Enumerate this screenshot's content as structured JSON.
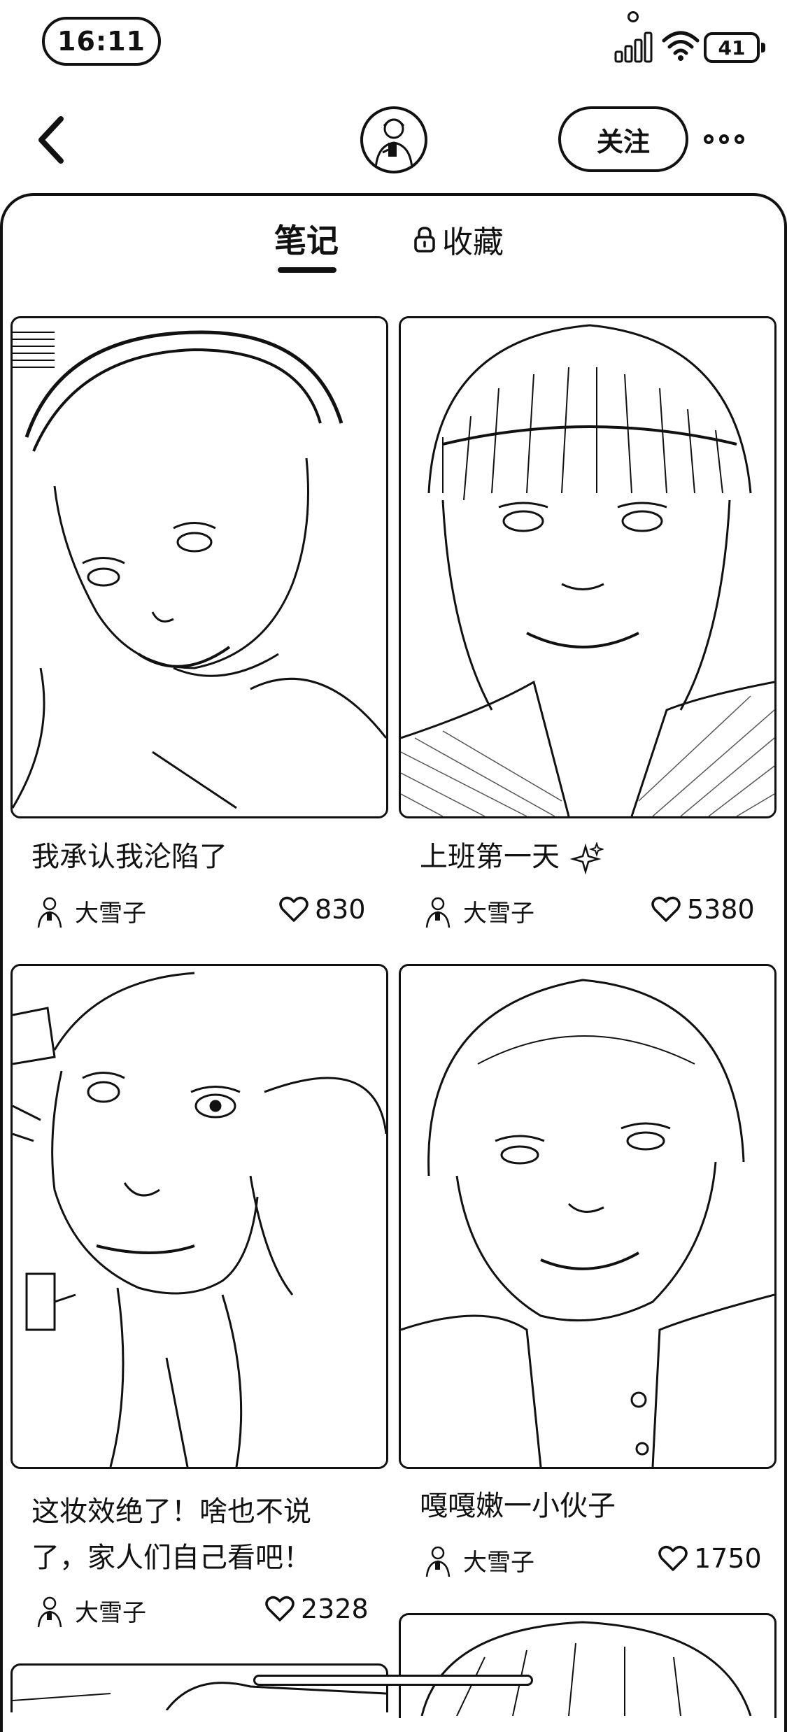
{
  "status_bar": {
    "time": "16:11",
    "battery": "41"
  },
  "header": {
    "back_icon": "chevron-left-icon",
    "avatar_icon": "user-avatar",
    "follow_label": "关注",
    "more_icon": "more-dots-icon"
  },
  "tabs": [
    {
      "label": "笔记",
      "active": true
    },
    {
      "label": "收藏",
      "active": false,
      "icon": "lock-icon"
    }
  ],
  "notes": [
    {
      "title": "我承认我沦陷了",
      "author": "大雪子",
      "likes": "830"
    },
    {
      "title": "上班第一天",
      "title_icon": "sparkle-icon",
      "author": "大雪子",
      "likes": "5380"
    },
    {
      "title_line1": "这妆效绝了！啥也不说",
      "title_line2": "了，家人们自己看吧！",
      "author": "大雪子",
      "likes": "2328"
    },
    {
      "title": "嘎嘎嫩一小伙子",
      "author": "大雪子",
      "likes": "1750"
    }
  ],
  "colors": {
    "ink": "#111111",
    "background": "#ffffff"
  }
}
